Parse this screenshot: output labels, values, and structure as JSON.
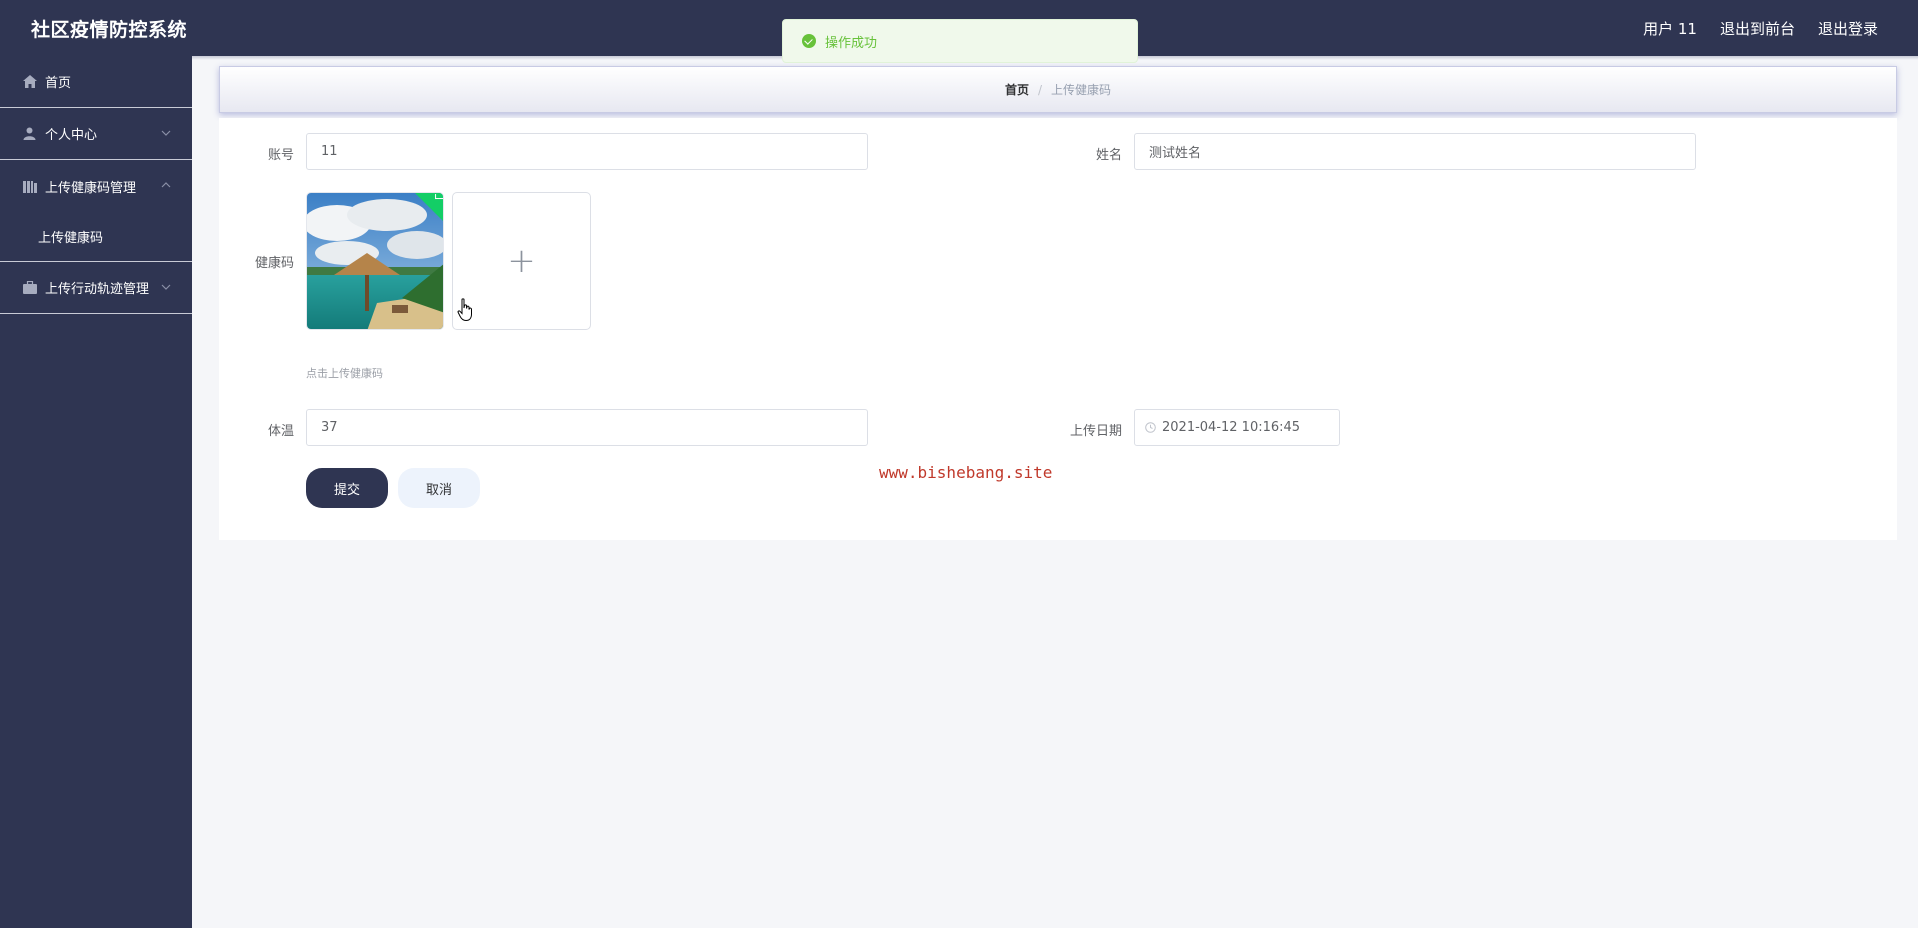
{
  "app": {
    "title": "社区疫情防控系统"
  },
  "header": {
    "user_label": "用户 11",
    "to_front_label": "退出到前台",
    "logout_label": "退出登录"
  },
  "sidebar": {
    "items": [
      {
        "label": "首页",
        "icon": "home-icon"
      },
      {
        "label": "个人中心",
        "icon": "user-icon",
        "arrow": "down"
      },
      {
        "label": "上传健康码管理",
        "icon": "grid-icon",
        "arrow": "up",
        "children": [
          {
            "label": "上传健康码"
          }
        ]
      },
      {
        "label": "上传行动轨迹管理",
        "icon": "briefcase-icon",
        "arrow": "down"
      }
    ]
  },
  "breadcrumb": {
    "home": "首页",
    "separator": "/",
    "current": "上传健康码"
  },
  "form": {
    "account": {
      "label": "账号",
      "value": "11"
    },
    "name": {
      "label": "姓名",
      "value": "测试姓名"
    },
    "health_code": {
      "label": "健康码",
      "tip": "点击上传健康码"
    },
    "temperature": {
      "label": "体温",
      "value": "37"
    },
    "upload_date": {
      "label": "上传日期",
      "value": "2021-04-12 10:16:45"
    },
    "submit_label": "提交",
    "cancel_label": "取消"
  },
  "toast": {
    "message": "操作成功",
    "type": "success"
  },
  "watermark": "www.bishebang.site",
  "colors": {
    "sidebar_bg": "#2f3552",
    "page_bg": "#f5f6f9",
    "success": "#67c23a",
    "submit_bg": "#2f3552",
    "cancel_bg": "#edf3fc",
    "watermark": "#c0392b"
  }
}
